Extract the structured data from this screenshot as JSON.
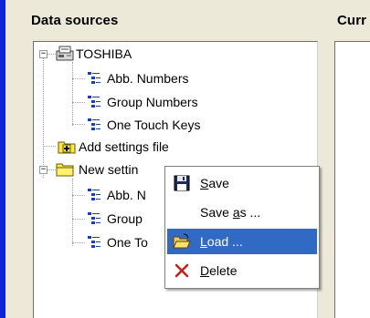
{
  "left_panel": {
    "title": "Data sources",
    "tree": {
      "toshiba": {
        "label": "TOSHIBA",
        "expander": "−"
      },
      "toshiba_children": [
        {
          "label": "Abb. Numbers"
        },
        {
          "label": "Group Numbers"
        },
        {
          "label": "One Touch Keys"
        }
      ],
      "add_settings": {
        "label": "Add settings file"
      },
      "new_settings": {
        "label": "New settin",
        "expander": "−"
      },
      "new_settings_children": [
        {
          "label": "Abb. N"
        },
        {
          "label": "Group"
        },
        {
          "label": "One To"
        }
      ]
    }
  },
  "right_panel": {
    "title": "Curr"
  },
  "context_menu": {
    "items": [
      {
        "pre": "",
        "mnemonic": "S",
        "post": "ave",
        "icon": "floppy-disk-icon"
      },
      {
        "pre": "Save ",
        "mnemonic": "a",
        "post": "s ...",
        "icon": ""
      },
      {
        "pre": "",
        "mnemonic": "L",
        "post": "oad ...",
        "icon": "open-folder-icon",
        "highlighted": true
      },
      {
        "pre": "",
        "mnemonic": "D",
        "post": "elete",
        "icon": "delete-x-icon"
      }
    ]
  },
  "colors": {
    "highlight": "#316ac5",
    "accent_blue": "#0a24d6",
    "dialog_bg": "#ece9d8"
  }
}
